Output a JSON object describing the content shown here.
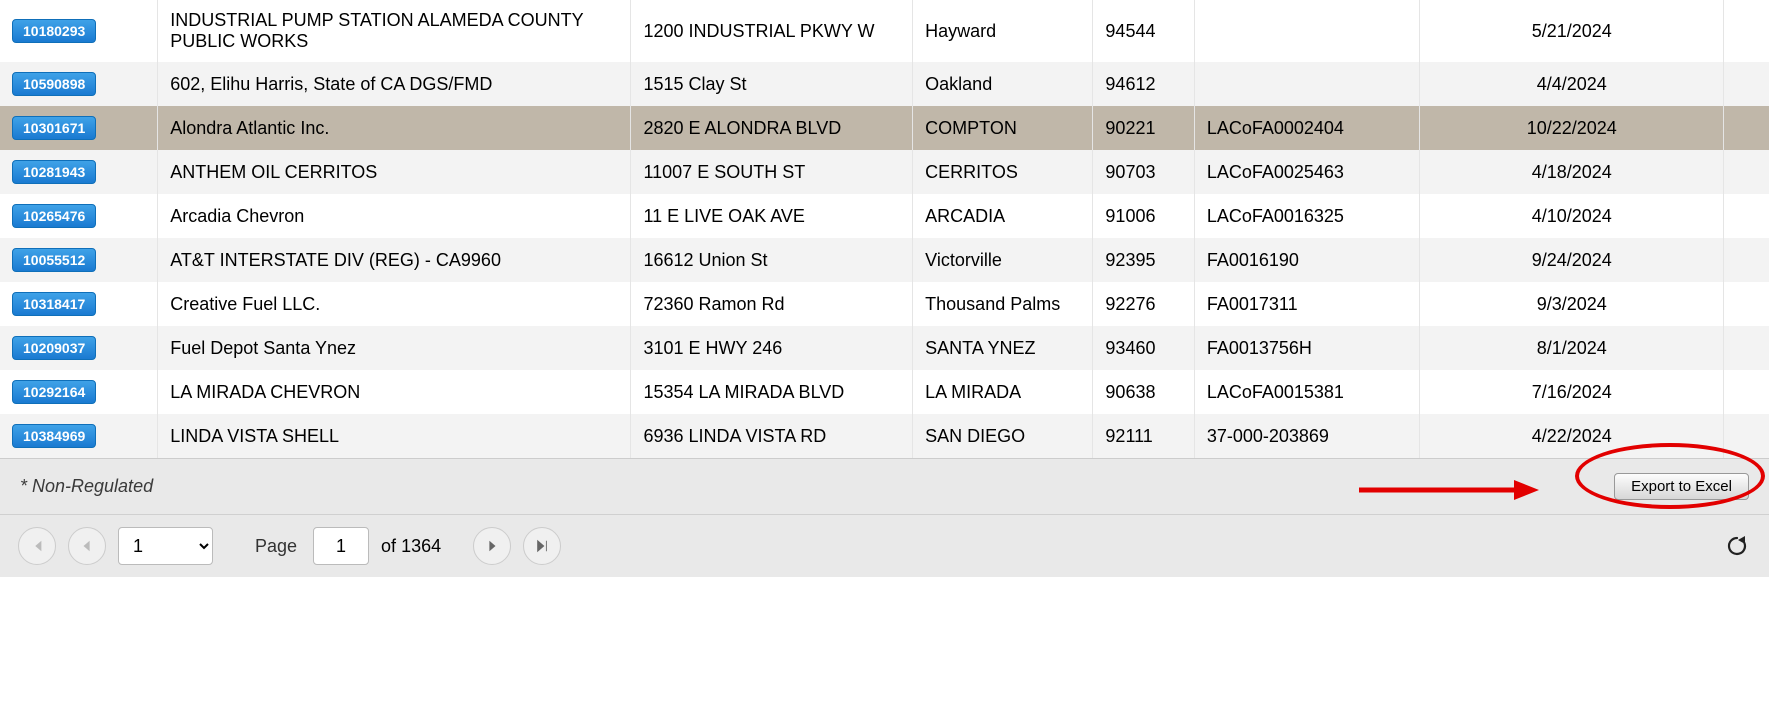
{
  "rows": [
    {
      "id": "10180293",
      "name": "INDUSTRIAL PUMP STATION ALAMEDA COUNTY PUBLIC WORKS",
      "addr": "1200 INDUSTRIAL PKWY W",
      "city": "Hayward",
      "zip": "94544",
      "facid": "",
      "date": "5/21/2024",
      "selected": false
    },
    {
      "id": "10590898",
      "name": "602, Elihu Harris, State of CA DGS/FMD",
      "addr": "1515 Clay St",
      "city": "Oakland",
      "zip": "94612",
      "facid": "",
      "date": "4/4/2024",
      "selected": false
    },
    {
      "id": "10301671",
      "name": "Alondra Atlantic Inc.",
      "addr": "2820 E ALONDRA BLVD",
      "city": "COMPTON",
      "zip": "90221",
      "facid": "LACoFA0002404",
      "date": "10/22/2024",
      "selected": true
    },
    {
      "id": "10281943",
      "name": "ANTHEM OIL CERRITOS",
      "addr": "11007 E SOUTH ST",
      "city": "CERRITOS",
      "zip": "90703",
      "facid": "LACoFA0025463",
      "date": "4/18/2024",
      "selected": false
    },
    {
      "id": "10265476",
      "name": "Arcadia Chevron",
      "addr": "11 E LIVE OAK AVE",
      "city": "ARCADIA",
      "zip": "91006",
      "facid": "LACoFA0016325",
      "date": "4/10/2024",
      "selected": false
    },
    {
      "id": "10055512",
      "name": "AT&T INTERSTATE DIV (REG) - CA9960",
      "addr": "16612 Union St",
      "city": "Victorville",
      "zip": "92395",
      "facid": "FA0016190",
      "date": "9/24/2024",
      "selected": false
    },
    {
      "id": "10318417",
      "name": "Creative Fuel LLC.",
      "addr": "72360 Ramon Rd",
      "city": "Thousand Palms",
      "zip": "92276",
      "facid": "FA0017311",
      "date": "9/3/2024",
      "selected": false
    },
    {
      "id": "10209037",
      "name": "Fuel Depot Santa Ynez",
      "addr": "3101 E HWY 246",
      "city": "SANTA YNEZ",
      "zip": "93460",
      "facid": "FA0013756H",
      "date": "8/1/2024",
      "selected": false
    },
    {
      "id": "10292164",
      "name": "LA MIRADA CHEVRON",
      "addr": "15354 LA MIRADA BLVD",
      "city": "LA MIRADA",
      "zip": "90638",
      "facid": "LACoFA0015381",
      "date": "7/16/2024",
      "selected": false
    },
    {
      "id": "10384969",
      "name": "LINDA VISTA SHELL",
      "addr": "6936 LINDA VISTA RD",
      "city": "SAN DIEGO",
      "zip": "92111",
      "facid": "37-000-203869",
      "date": "4/22/2024",
      "selected": false
    }
  ],
  "footer": {
    "note": "* Non-Regulated",
    "export_label": "Export to Excel"
  },
  "pager": {
    "page_label": "Page",
    "of_label": "of",
    "total_pages": "1364",
    "current_page": "1",
    "select_value": "1"
  }
}
